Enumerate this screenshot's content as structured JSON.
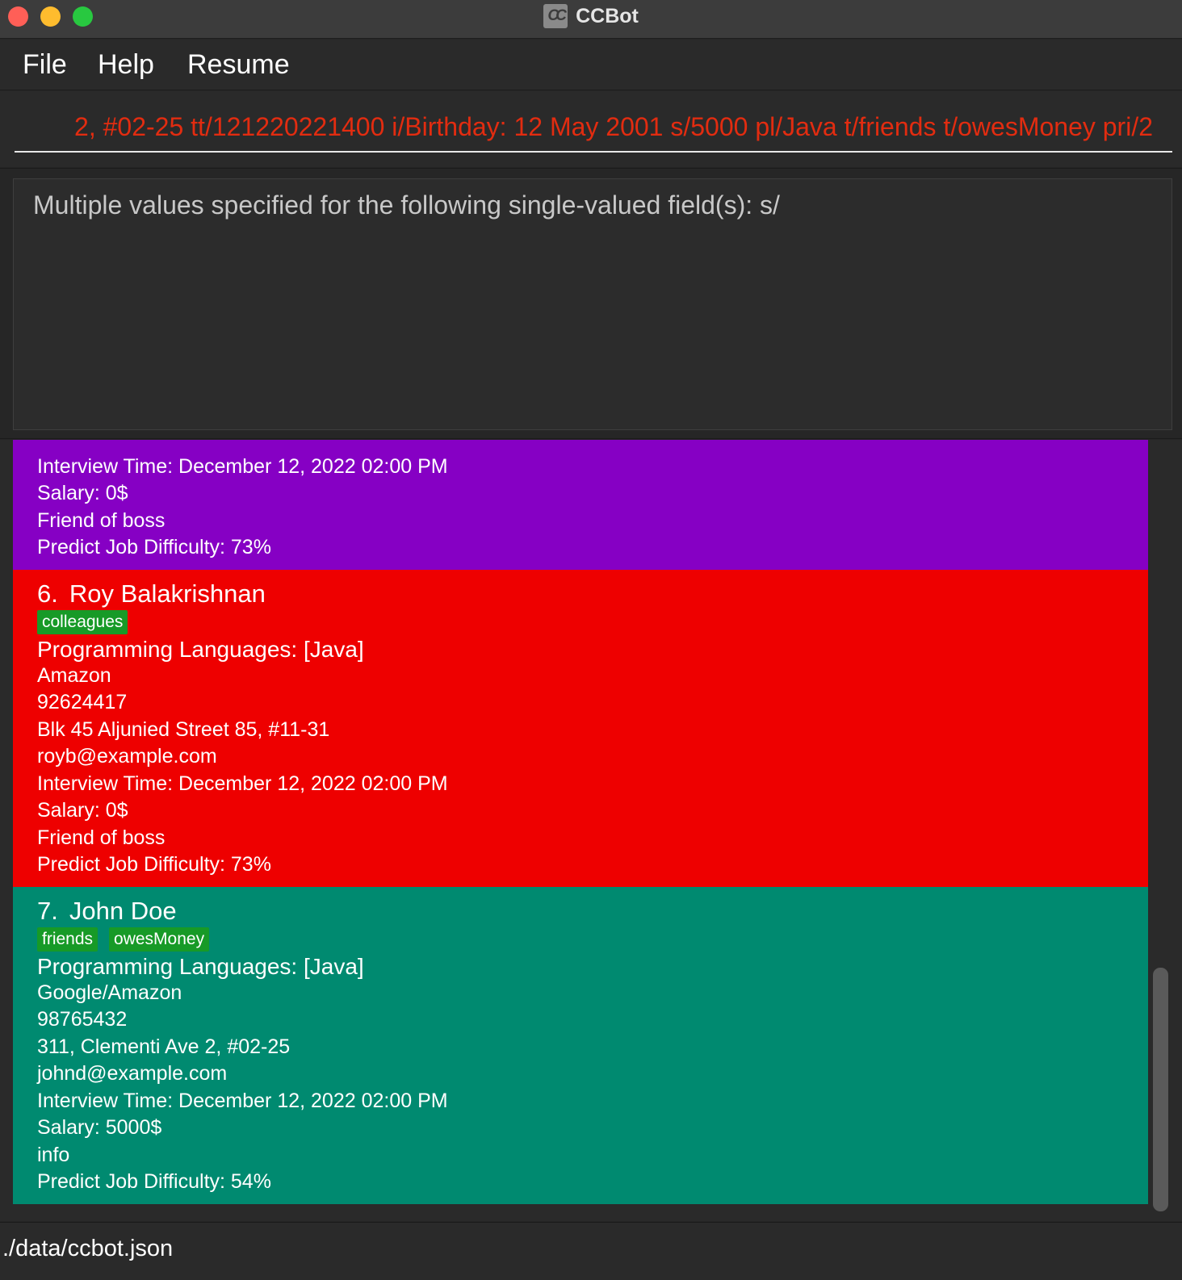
{
  "window": {
    "title": "CCBot",
    "icon_text": "CC",
    "icon": "ccbot-app-icon"
  },
  "menu": {
    "file": "File",
    "help": "Help",
    "resume": "Resume"
  },
  "command": {
    "value": "2, #02-25 tt/121220221400 i/Birthday: 12 May 2001 s/5000 pl/Java t/friends t/owesMoney pri/2",
    "color": "#e22c10"
  },
  "result": {
    "message": "Multiple values specified for the following single-valued field(s): s/"
  },
  "persons": [
    {
      "color": "#8600c4",
      "interview": "Interview Time: December 12, 2022 02:00 PM",
      "salary": "Salary: 0$",
      "info": "Friend of boss",
      "difficulty": "Predict Job Difficulty: 73%"
    },
    {
      "color": "#ee0000",
      "index": "6.",
      "name": "Roy Balakrishnan",
      "tags": [
        "colleagues"
      ],
      "languages": "Programming Languages: [Java]",
      "company": "Amazon",
      "phone": "92624417",
      "address": "Blk 45 Aljunied Street 85, #11-31",
      "email": "royb@example.com",
      "interview": "Interview Time: December 12, 2022 02:00 PM",
      "salary": "Salary: 0$",
      "info": "Friend of boss",
      "difficulty": "Predict Job Difficulty: 73%"
    },
    {
      "color": "#008a70",
      "index": "7.",
      "name": "John Doe",
      "tags": [
        "friends",
        "owesMoney"
      ],
      "languages": "Programming Languages: [Java]",
      "company": "Google/Amazon",
      "phone": "98765432",
      "address": "311, Clementi Ave 2, #02-25",
      "email": "johnd@example.com",
      "interview": "Interview Time: December 12, 2022 02:00 PM",
      "salary": "Salary: 5000$",
      "info": "info",
      "difficulty": "Predict Job Difficulty: 54%"
    }
  ],
  "tag_color": "#179a27",
  "status": {
    "path": "./data/ccbot.json"
  }
}
